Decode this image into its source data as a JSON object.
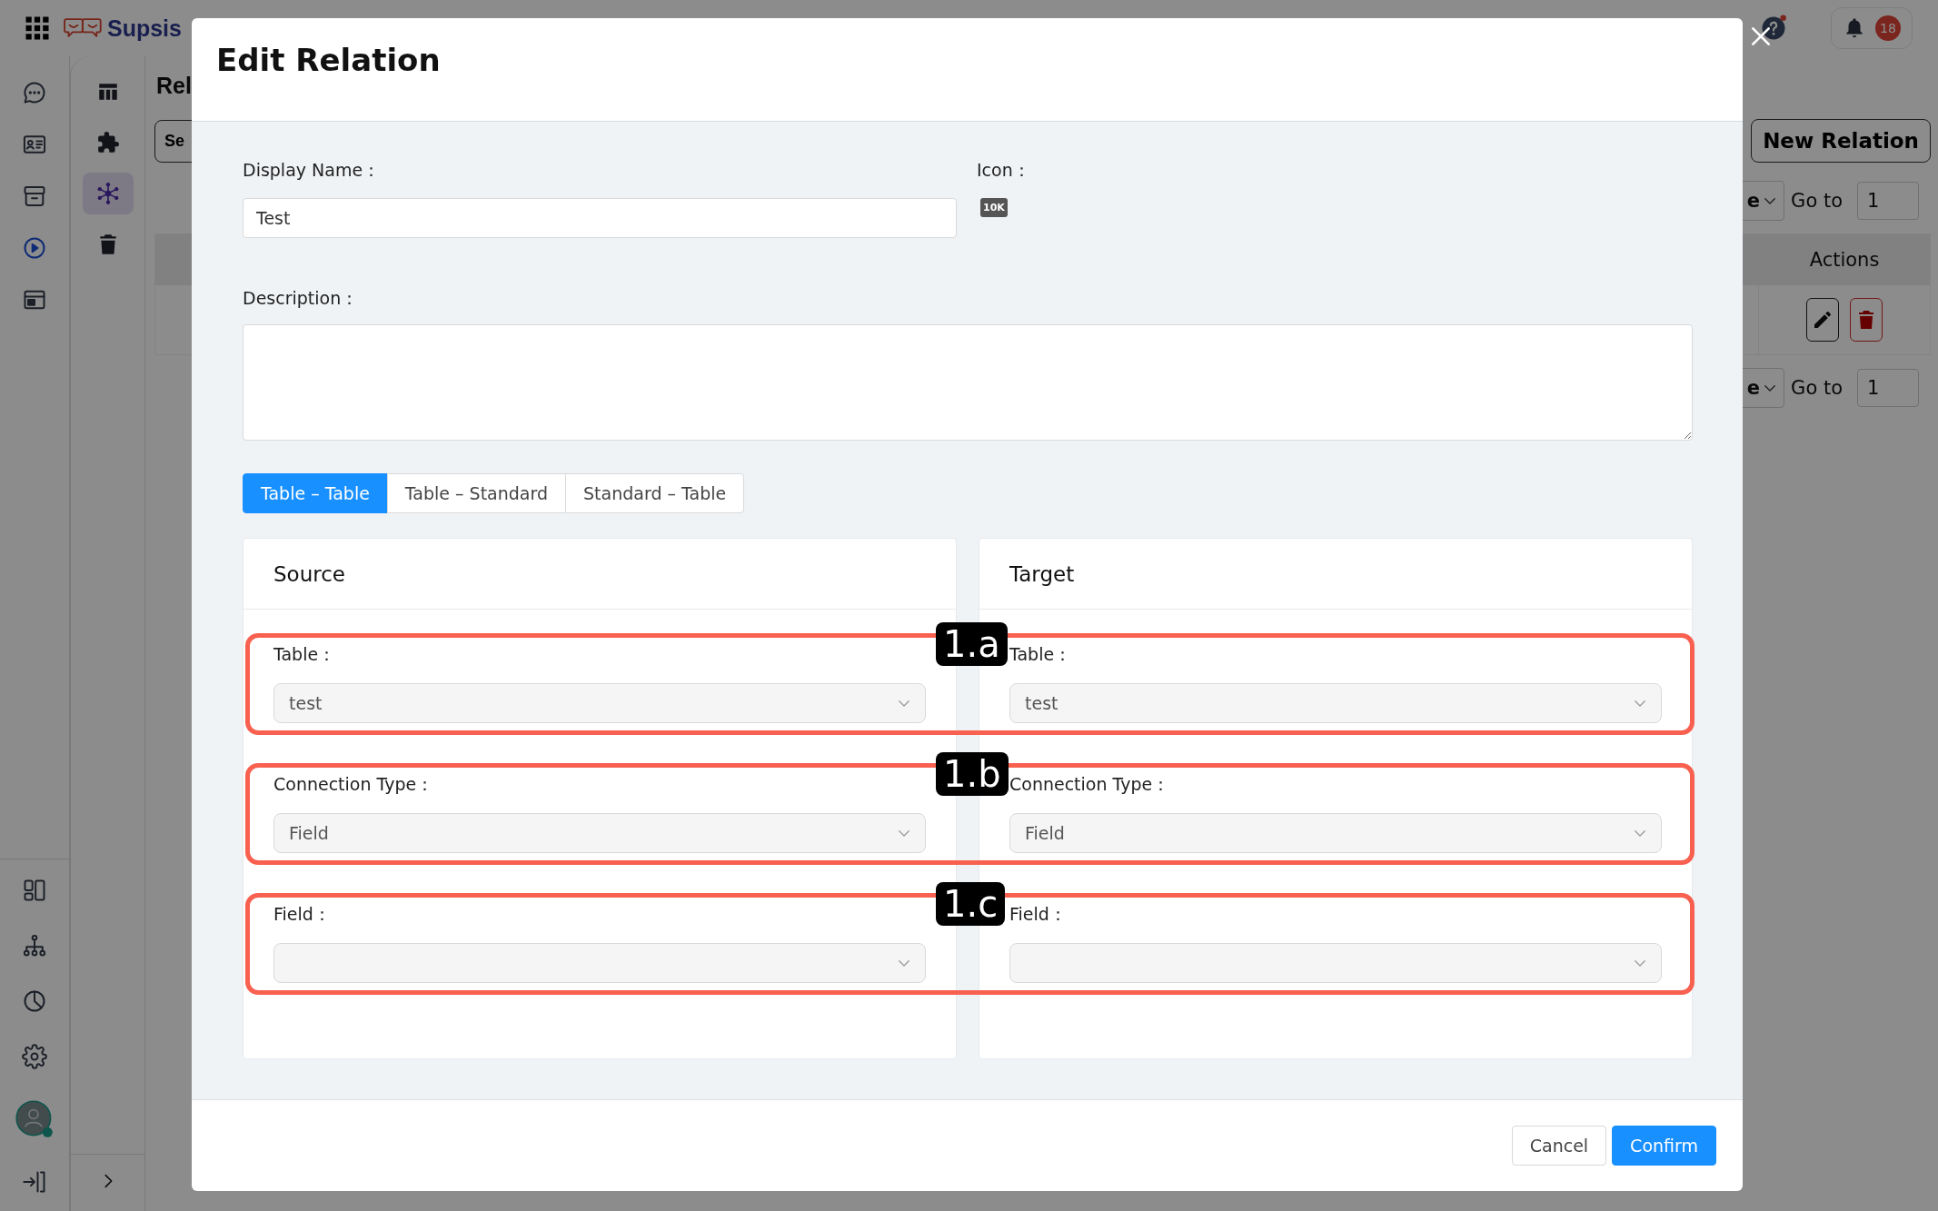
{
  "top_bar": {
    "logo": "Supsis",
    "notification_count": "18"
  },
  "nav_rail": {
    "items": [
      {
        "selected": false
      },
      {
        "selected": false
      },
      {
        "selected": false
      },
      {
        "selected": true
      },
      {
        "selected": false
      }
    ]
  },
  "sub_nav": {
    "items": [
      {
        "selected": false
      },
      {
        "selected": false
      },
      {
        "selected": true
      },
      {
        "selected": false
      }
    ]
  },
  "page": {
    "title": "Rel",
    "search_button": "Se",
    "new_button": "New Relation",
    "paginations": [
      {
        "page_size": "e",
        "goto_label": "Go to",
        "goto_value": "1"
      },
      {
        "page_size": "e",
        "goto_label": "Go to",
        "goto_value": "1"
      }
    ],
    "table": {
      "columns": [
        "Actions"
      ]
    }
  },
  "modal": {
    "title": "Edit Relation",
    "display_name": {
      "label": "Display Name：",
      "value": "Test"
    },
    "icon": {
      "label": "Icon：",
      "badge": "10K"
    },
    "description": {
      "label": "Description："
    },
    "tabs": [
      {
        "label": "Table – Table",
        "selected": true
      },
      {
        "label": "Table – Standard",
        "selected": false
      },
      {
        "label": "Standard – Table",
        "selected": false
      }
    ],
    "panels": [
      {
        "title": "Source",
        "fields": [
          {
            "label": "Table：",
            "value": "test"
          },
          {
            "label": "Connection Type：",
            "value": "Field"
          },
          {
            "label": "Field："
          }
        ]
      },
      {
        "title": "Target",
        "fields": [
          {
            "label": "Table：",
            "value": "test"
          },
          {
            "label": "Connection Type：",
            "value": "Field"
          },
          {
            "label": "Field："
          }
        ]
      }
    ],
    "buttons": [
      {
        "label": "Cancel",
        "kind": "secondary"
      },
      {
        "label": "Confirm",
        "kind": "primary"
      }
    ]
  },
  "annotations": [
    {
      "label": "1.a"
    },
    {
      "label": "1.b"
    },
    {
      "label": "1.c"
    }
  ]
}
